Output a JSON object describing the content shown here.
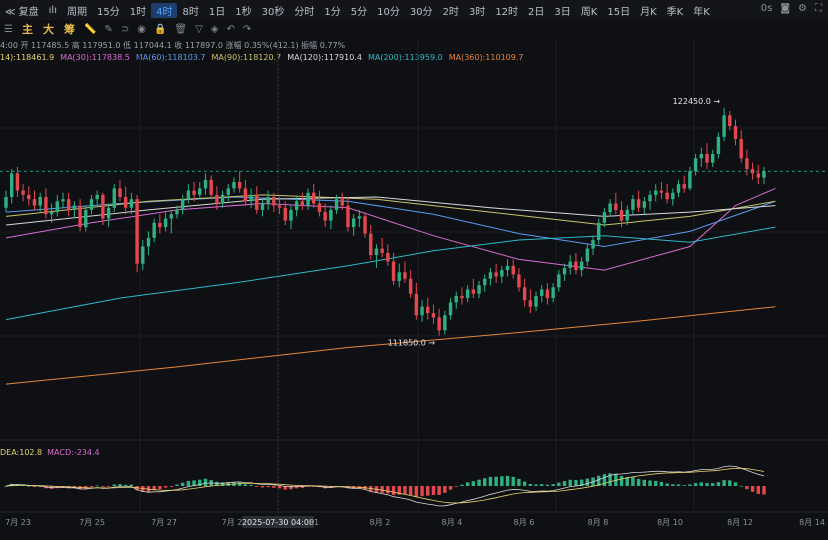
{
  "toolbar": {
    "items": [
      "≪ 复盘",
      "ılı",
      "周期",
      "15分",
      "1时",
      "4时",
      "8时",
      "1日",
      "1秒",
      "30秒",
      "分时",
      "1分",
      "5分",
      "10分",
      "30分",
      "2时",
      "3时",
      "12时",
      "2日",
      "3日",
      "周K",
      "15日",
      "月K",
      "季K",
      "年K"
    ],
    "active_index": 5,
    "right_label": "0s"
  },
  "tags": [
    "主",
    "大",
    "筹"
  ],
  "ohlc_text": "4:00 开 117485.5 高 117951.0 低 117044.1 收 117897.0 涨幅 0.35%(412.1) 振幅 0.77%",
  "ma_labels": [
    {
      "text": "14):118461.9",
      "color": "#e8d36a"
    },
    {
      "text": "MA(30):117838.5",
      "color": "#d86bd0"
    },
    {
      "text": "MA(60):118103.7",
      "color": "#5a9bf0"
    },
    {
      "text": "MA(90):118120.7",
      "color": "#c9c36b"
    },
    {
      "text": "MA(120):117910.4",
      "color": "#d8d8d8"
    },
    {
      "text": "MA(200):113959.0",
      "color": "#2fb8c8"
    },
    {
      "text": "MA(360):110109.7",
      "color": "#e3863a"
    }
  ],
  "macd_labels": [
    {
      "text": "DEA:102.8",
      "color": "#e8d36a"
    },
    {
      "text": "MACD:-234.4",
      "color": "#d86bd0"
    }
  ],
  "colors": {
    "up": "#2fb083",
    "down": "#e2494f"
  },
  "chart_data": {
    "type": "candlestick",
    "interval": "4时",
    "high_label": "122450.0",
    "low_label": "111850.0",
    "x_tick_labels": [
      "7月 23",
      "7月 25",
      "7月 27",
      "7月 2",
      "2025-07-30 04:00",
      "31",
      "8月 2",
      "8月 4",
      "8月 6",
      "8月 8",
      "8月 10",
      "8月 12",
      "8月 14"
    ],
    "ohlc": [
      [
        117800,
        118600,
        117600,
        118300
      ],
      [
        118300,
        119600,
        118000,
        119400
      ],
      [
        119400,
        119700,
        118300,
        118600
      ],
      [
        118600,
        118900,
        118100,
        118400
      ],
      [
        118400,
        118800,
        117900,
        118200
      ],
      [
        118200,
        118600,
        117700,
        117900
      ],
      [
        117900,
        118500,
        117600,
        118300
      ],
      [
        118300,
        118700,
        117300,
        117500
      ],
      [
        117500,
        118000,
        117100,
        117600
      ],
      [
        117600,
        118400,
        117400,
        118100
      ],
      [
        118100,
        118500,
        117800,
        118200
      ],
      [
        118200,
        118500,
        117400,
        117700
      ],
      [
        117700,
        118100,
        117300,
        117900
      ],
      [
        117900,
        118200,
        116700,
        116900
      ],
      [
        116900,
        117900,
        116700,
        117700
      ],
      [
        117700,
        118400,
        117500,
        118200
      ],
      [
        118200,
        118600,
        117900,
        118400
      ],
      [
        118400,
        118500,
        117000,
        117300
      ],
      [
        117300,
        118000,
        116900,
        117800
      ],
      [
        117800,
        118900,
        117600,
        118700
      ],
      [
        118700,
        119100,
        118100,
        118300
      ],
      [
        118300,
        118800,
        117500,
        117800
      ],
      [
        117800,
        118500,
        117500,
        118200
      ],
      [
        118200,
        118400,
        114800,
        115200
      ],
      [
        115200,
        116300,
        114900,
        116000
      ],
      [
        116000,
        116700,
        115600,
        116400
      ],
      [
        116400,
        117300,
        116200,
        117100
      ],
      [
        117100,
        117500,
        116600,
        116900
      ],
      [
        116900,
        117600,
        116700,
        117300
      ],
      [
        117300,
        117700,
        116600,
        117500
      ],
      [
        117500,
        117900,
        117300,
        117700
      ],
      [
        117700,
        118400,
        117500,
        118200
      ],
      [
        118200,
        118900,
        118000,
        118600
      ],
      [
        118600,
        119000,
        118100,
        118400
      ],
      [
        118400,
        119000,
        118200,
        118700
      ],
      [
        118700,
        119400,
        118400,
        119100
      ],
      [
        119100,
        119300,
        118200,
        118400
      ],
      [
        118400,
        118800,
        117700,
        118000
      ],
      [
        118000,
        118600,
        117800,
        118400
      ],
      [
        118400,
        118900,
        118100,
        118700
      ],
      [
        118700,
        119200,
        118500,
        119000
      ],
      [
        119000,
        119500,
        118500,
        118700
      ],
      [
        118700,
        119100,
        117900,
        118100
      ],
      [
        118100,
        118700,
        117800,
        118400
      ],
      [
        118400,
        118800,
        117500,
        117700
      ],
      [
        117700,
        118200,
        117400,
        118000
      ],
      [
        118000,
        118600,
        117700,
        118300
      ],
      [
        118300,
        118500,
        117600,
        117900
      ],
      [
        117900,
        118300,
        117500,
        117800
      ],
      [
        117800,
        118100,
        117000,
        117200
      ],
      [
        117200,
        117900,
        116800,
        117700
      ],
      [
        117700,
        118300,
        117400,
        118100
      ],
      [
        118100,
        118500,
        117700,
        117900
      ],
      [
        117900,
        118700,
        117700,
        118500
      ],
      [
        118500,
        118900,
        117800,
        118000
      ],
      [
        118000,
        118600,
        117400,
        117600
      ],
      [
        117600,
        118000,
        116900,
        117200
      ],
      [
        117200,
        117900,
        116800,
        117700
      ],
      [
        117700,
        118400,
        117500,
        118200
      ],
      [
        118200,
        118500,
        117700,
        117900
      ],
      [
        117900,
        118300,
        116700,
        116900
      ],
      [
        116900,
        117500,
        116500,
        117300
      ],
      [
        117300,
        117700,
        116900,
        117400
      ],
      [
        117400,
        117600,
        116400,
        116600
      ],
      [
        116600,
        117000,
        115400,
        115600
      ],
      [
        115600,
        116100,
        115000,
        115900
      ],
      [
        115900,
        116400,
        115500,
        115700
      ],
      [
        115700,
        116100,
        115100,
        115300
      ],
      [
        115300,
        115700,
        114200,
        114400
      ],
      [
        114400,
        115200,
        114100,
        114800
      ],
      [
        114800,
        115300,
        114300,
        114500
      ],
      [
        114500,
        114900,
        113600,
        113800
      ],
      [
        113800,
        114300,
        112600,
        112800
      ],
      [
        112800,
        113500,
        112500,
        113200
      ],
      [
        113200,
        113600,
        112600,
        112900
      ],
      [
        112900,
        113300,
        112400,
        112700
      ],
      [
        112700,
        113100,
        111850,
        112100
      ],
      [
        112100,
        113000,
        111900,
        112800
      ],
      [
        112800,
        113600,
        112600,
        113400
      ],
      [
        113400,
        113900,
        113100,
        113700
      ],
      [
        113700,
        114100,
        113300,
        113600
      ],
      [
        113600,
        114200,
        113400,
        114000
      ],
      [
        114000,
        114500,
        113600,
        113800
      ],
      [
        113800,
        114400,
        113600,
        114200
      ],
      [
        114200,
        114700,
        113900,
        114500
      ],
      [
        114500,
        115000,
        114200,
        114800
      ],
      [
        114800,
        115200,
        114300,
        114600
      ],
      [
        114600,
        115100,
        114300,
        114900
      ],
      [
        114900,
        115400,
        114600,
        115100
      ],
      [
        115100,
        115400,
        114500,
        114700
      ],
      [
        114700,
        115000,
        113900,
        114100
      ],
      [
        114100,
        114500,
        113200,
        113500
      ],
      [
        113500,
        114000,
        112900,
        113200
      ],
      [
        113200,
        113900,
        113000,
        113700
      ],
      [
        113700,
        114200,
        113400,
        114000
      ],
      [
        114000,
        114300,
        113300,
        113600
      ],
      [
        113600,
        114300,
        113400,
        114100
      ],
      [
        114100,
        114900,
        113900,
        114700
      ],
      [
        114700,
        115200,
        114400,
        115000
      ],
      [
        115000,
        115600,
        114700,
        115300
      ],
      [
        115300,
        115700,
        114700,
        114900
      ],
      [
        114900,
        115500,
        114600,
        115300
      ],
      [
        115300,
        116100,
        115100,
        115900
      ],
      [
        115900,
        116500,
        115600,
        116300
      ],
      [
        116300,
        117300,
        116100,
        117100
      ],
      [
        117100,
        117800,
        116900,
        117600
      ],
      [
        117600,
        118200,
        117400,
        118000
      ],
      [
        118000,
        118500,
        117500,
        117700
      ],
      [
        117700,
        118100,
        116900,
        117200
      ],
      [
        117200,
        117900,
        117000,
        117700
      ],
      [
        117700,
        118400,
        117500,
        118200
      ],
      [
        118200,
        118600,
        117600,
        117800
      ],
      [
        117800,
        118300,
        117500,
        118100
      ],
      [
        118100,
        118600,
        117700,
        118400
      ],
      [
        118400,
        118900,
        118100,
        118600
      ],
      [
        118600,
        119000,
        118200,
        118500
      ],
      [
        118500,
        118900,
        118000,
        118200
      ],
      [
        118200,
        118700,
        117900,
        118500
      ],
      [
        118500,
        119100,
        118300,
        118900
      ],
      [
        118900,
        119300,
        118500,
        118700
      ],
      [
        118700,
        119700,
        118600,
        119500
      ],
      [
        119500,
        120300,
        119300,
        120100
      ],
      [
        120100,
        120600,
        119700,
        120300
      ],
      [
        120300,
        120800,
        119600,
        119900
      ],
      [
        119900,
        120500,
        119700,
        120300
      ],
      [
        120300,
        121300,
        120100,
        121100
      ],
      [
        121100,
        122450,
        120900,
        122100
      ],
      [
        122100,
        122300,
        121400,
        121600
      ],
      [
        121600,
        121900,
        120700,
        121000
      ],
      [
        121000,
        121400,
        119900,
        120100
      ],
      [
        120100,
        120500,
        119300,
        119600
      ],
      [
        119600,
        119900,
        119100,
        119400
      ],
      [
        119400,
        119800,
        118900,
        119200
      ],
      [
        119200,
        119700,
        118900,
        119500
      ]
    ],
    "ma_lines": [
      {
        "name": "MA(30)",
        "color": "#d86bd0",
        "points": [
          [
            0,
            116400
          ],
          [
            15,
            117100
          ],
          [
            30,
            117700
          ],
          [
            45,
            118000
          ],
          [
            60,
            117800
          ],
          [
            75,
            116500
          ],
          [
            90,
            115400
          ],
          [
            105,
            114900
          ],
          [
            120,
            116000
          ],
          [
            128,
            117900
          ],
          [
            135,
            118700
          ]
        ]
      },
      {
        "name": "MA(60)",
        "color": "#5a9bf0",
        "points": [
          [
            0,
            117600
          ],
          [
            20,
            118000
          ],
          [
            40,
            118300
          ],
          [
            60,
            118100
          ],
          [
            75,
            117500
          ],
          [
            90,
            116600
          ],
          [
            105,
            116000
          ],
          [
            120,
            116700
          ],
          [
            135,
            118100
          ]
        ]
      },
      {
        "name": "MA(90)",
        "color": "#c9c36b",
        "points": [
          [
            0,
            117400
          ],
          [
            25,
            118100
          ],
          [
            45,
            118400
          ],
          [
            65,
            118200
          ],
          [
            85,
            117600
          ],
          [
            105,
            117000
          ],
          [
            120,
            117400
          ],
          [
            135,
            118100
          ]
        ]
      },
      {
        "name": "MA(120)",
        "color": "#d8d8d8",
        "points": [
          [
            0,
            117000
          ],
          [
            25,
            117700
          ],
          [
            45,
            118200
          ],
          [
            65,
            118300
          ],
          [
            85,
            117800
          ],
          [
            105,
            117400
          ],
          [
            120,
            117600
          ],
          [
            135,
            117900
          ]
        ]
      },
      {
        "name": "MA(200)",
        "color": "#2fb8c8",
        "points": [
          [
            0,
            112600
          ],
          [
            20,
            113600
          ],
          [
            40,
            114300
          ],
          [
            60,
            115100
          ],
          [
            75,
            115800
          ],
          [
            90,
            116300
          ],
          [
            105,
            116500
          ],
          [
            120,
            116200
          ],
          [
            135,
            116900
          ]
        ]
      },
      {
        "name": "MA(360)",
        "color": "#e3863a",
        "points": [
          [
            0,
            109600
          ],
          [
            30,
            110400
          ],
          [
            60,
            111300
          ],
          [
            90,
            112000
          ],
          [
            110,
            112500
          ],
          [
            135,
            113200
          ]
        ]
      }
    ],
    "ylim": [
      107000,
      124300
    ]
  }
}
